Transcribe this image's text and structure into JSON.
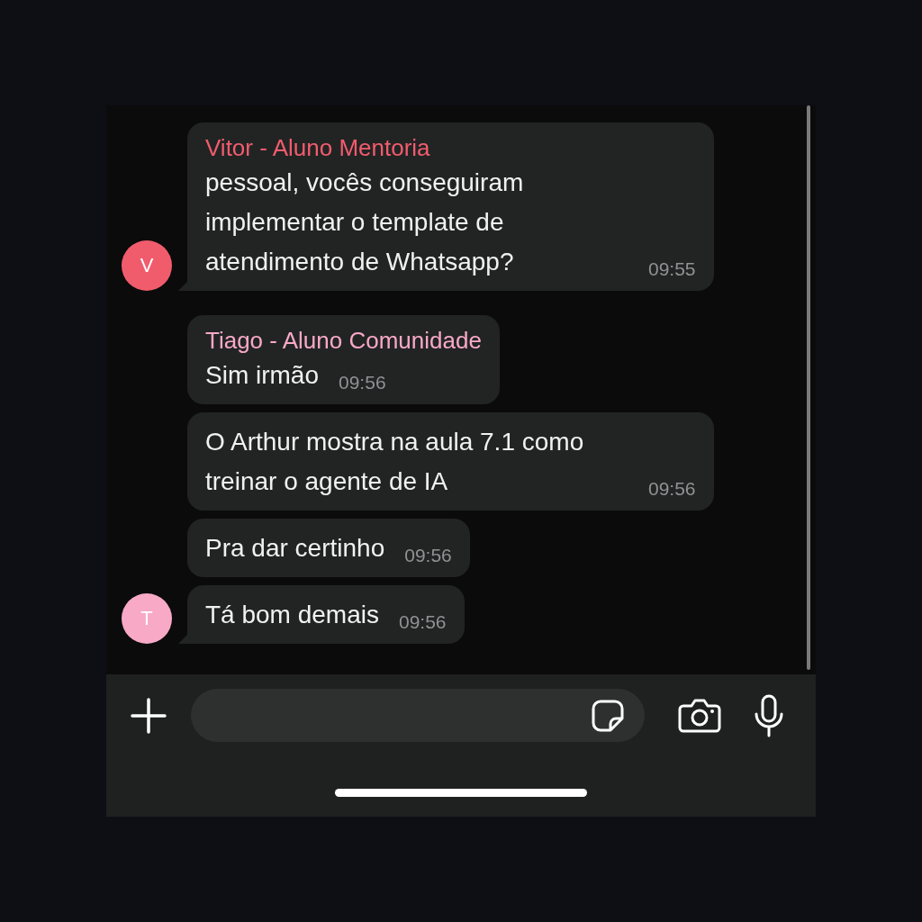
{
  "groups": [
    {
      "sender": {
        "name": "Vitor - Aluno Mentoria",
        "initial": "V",
        "color": "#f15c6d"
      },
      "messages": [
        {
          "text": "pessoal, vocês conseguiram implementar o template de atendimento de Whatsapp?",
          "time": "09:55"
        }
      ]
    },
    {
      "sender": {
        "name": "Tiago - Aluno Comunidade",
        "initial": "T",
        "color": "#f8a9c6"
      },
      "messages": [
        {
          "text": "Sim irmão",
          "time": "09:56"
        },
        {
          "text": "O Arthur mostra na aula 7.1 como treinar o agente de IA",
          "time": "09:56"
        },
        {
          "text": "Pra dar certinho",
          "time": "09:56"
        },
        {
          "text": "Tá bom demais",
          "time": "09:56"
        }
      ]
    }
  ]
}
